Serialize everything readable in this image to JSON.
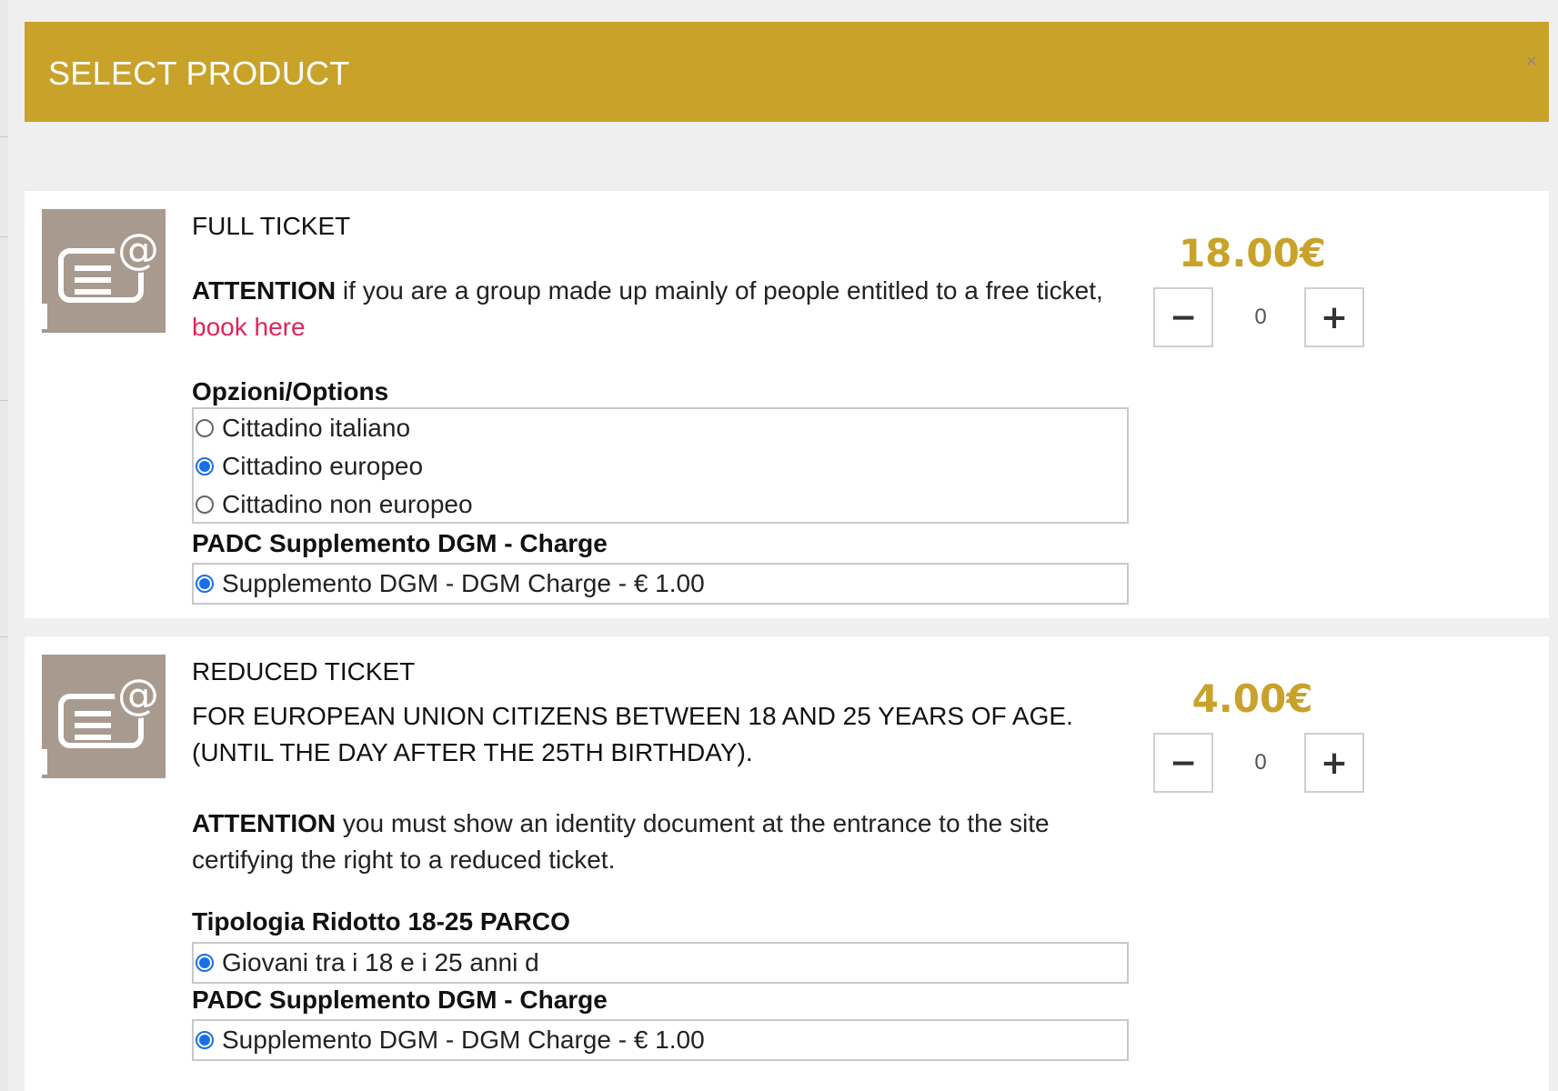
{
  "modal": {
    "title": "SELECT PRODUCT",
    "close_glyph": "×",
    "accent_color": "#c9a22a",
    "link_color": "#e0245e"
  },
  "products": [
    {
      "title": "FULL TICKET",
      "thumb_icon": "email-at-icon",
      "attention_bold": "ATTENTION",
      "attention_text": " if you are a group made up mainly of people entitled to a free ticket, ",
      "attention_link": "book here",
      "price": "18.00€",
      "quantity": "0",
      "option_groups": [
        {
          "label": "Opzioni/Options",
          "options": [
            {
              "label": "Cittadino italiano",
              "selected": false
            },
            {
              "label": "Cittadino europeo",
              "selected": true
            },
            {
              "label": "Cittadino non europeo",
              "selected": false
            }
          ]
        },
        {
          "label": "PADC Supplemento DGM - Charge",
          "options": [
            {
              "label": "Supplemento DGM - DGM Charge - € 1.00",
              "selected": true
            }
          ]
        }
      ]
    },
    {
      "title": "REDUCED TICKET",
      "thumb_icon": "email-at-icon",
      "description": "FOR EUROPEAN UNION CITIZENS BETWEEN 18 AND 25 YEARS OF AGE. (UNTIL THE DAY AFTER THE 25TH BIRTHDAY).",
      "attention_bold": "ATTENTION",
      "attention_text": " you must show an identity document at the entrance to the site certifying the right to a reduced ticket.",
      "price": "4.00€",
      "quantity": "0",
      "option_groups": [
        {
          "label": "Tipologia Ridotto 18-25 PARCO",
          "options": [
            {
              "label": "Giovani tra i 18 e i 25 anni d",
              "selected": true
            }
          ]
        },
        {
          "label": "PADC Supplemento DGM - Charge",
          "options": [
            {
              "label": "Supplemento DGM - DGM Charge - € 1.00",
              "selected": true
            }
          ]
        }
      ]
    }
  ],
  "stepper": {
    "minus_glyph": "−",
    "plus_glyph": "+"
  }
}
